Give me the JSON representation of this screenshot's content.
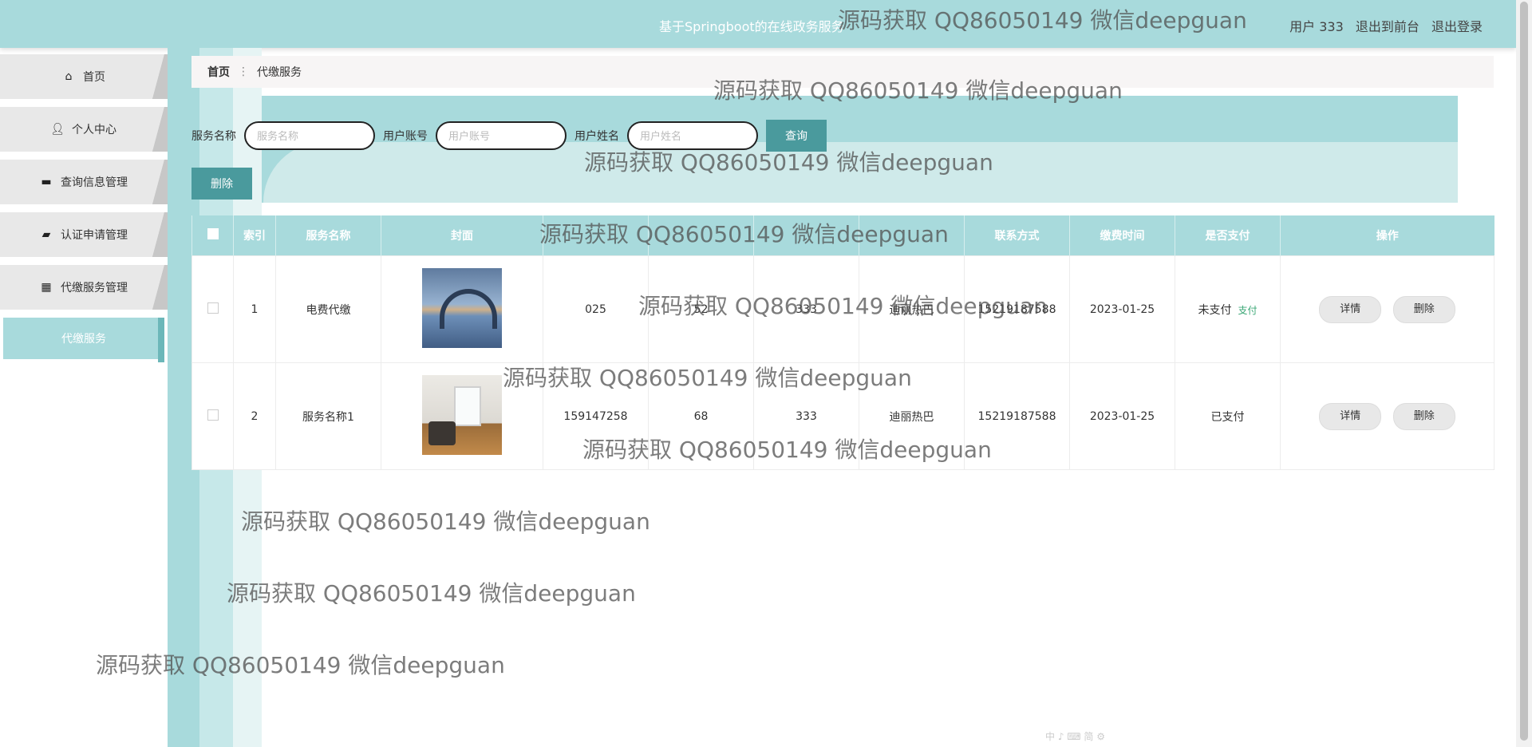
{
  "header": {
    "app_title": "基于Springboot的在线政务服务",
    "user": "用户 333",
    "to_front": "退出到前台",
    "logout": "退出登录"
  },
  "sidebar": {
    "items": [
      {
        "label": "首页",
        "icon": "home-icon"
      },
      {
        "label": "个人中心",
        "icon": "user-icon"
      },
      {
        "label": "查询信息管理",
        "icon": "monitor-icon"
      },
      {
        "label": "认证申请管理",
        "icon": "wallet-icon"
      },
      {
        "label": "代缴服务管理",
        "icon": "grid-icon"
      }
    ],
    "active_item": "代缴服务"
  },
  "breadcrumb": {
    "home": "首页",
    "current": "代缴服务"
  },
  "search": {
    "service_label": "服务名称",
    "service_placeholder": "服务名称",
    "account_label": "用户账号",
    "account_placeholder": "用户账号",
    "name_label": "用户姓名",
    "name_placeholder": "用户姓名",
    "query_button": "查询"
  },
  "delete_button": "删除",
  "table": {
    "columns": [
      "索引",
      "服务名称",
      "封面",
      "",
      "",
      "",
      "",
      "联系方式",
      "缴费时间",
      "是否支付",
      "操作"
    ],
    "rows": [
      {
        "index": "1",
        "service": "电费代缴",
        "c4": "025",
        "c5": "52",
        "c6": "333",
        "c7": "迪丽热巴",
        "phone": "15219187588",
        "time": "2023-01-25",
        "paid": "未支付",
        "pay_link": "支付"
      },
      {
        "index": "2",
        "service": "服务名称1",
        "c4": "159147258",
        "c5": "68",
        "c6": "333",
        "c7": "迪丽热巴",
        "phone": "15219187588",
        "time": "2023-01-25",
        "paid": "已支付",
        "pay_link": ""
      }
    ],
    "detail_button": "详情",
    "delete_button": "删除"
  },
  "watermark": "源码获取 QQ86050149 微信deepguan",
  "ime_bar": "中 ♪ ⌨ 简 ⚙"
}
